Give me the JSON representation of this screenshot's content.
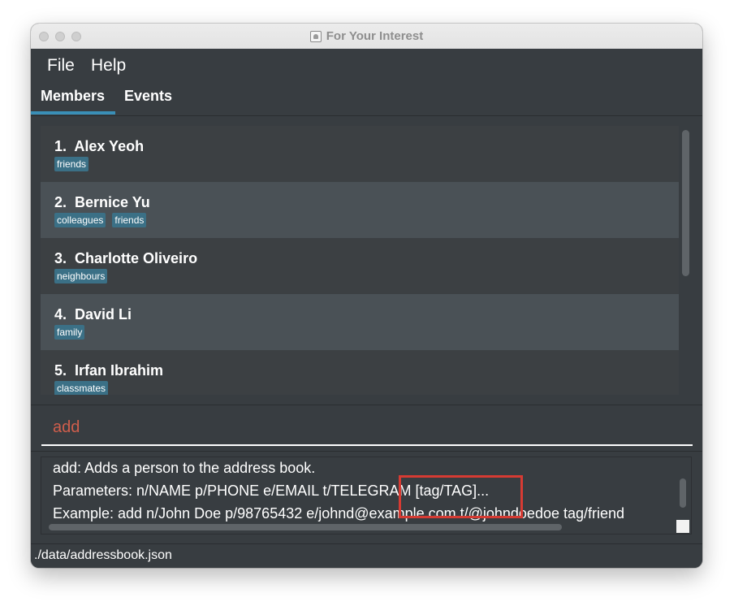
{
  "window": {
    "title": "For Your Interest"
  },
  "menu": {
    "file": "File",
    "help": "Help"
  },
  "tabs": {
    "members": "Members",
    "events": "Events"
  },
  "members": [
    {
      "index": "1.",
      "name": "Alex Yeoh",
      "tags": [
        "friends"
      ]
    },
    {
      "index": "2.",
      "name": "Bernice Yu",
      "tags": [
        "colleagues",
        "friends"
      ]
    },
    {
      "index": "3.",
      "name": "Charlotte Oliveiro",
      "tags": [
        "neighbours"
      ]
    },
    {
      "index": "4.",
      "name": "David Li",
      "tags": [
        "family"
      ]
    },
    {
      "index": "5.",
      "name": "Irfan Ibrahim",
      "tags": [
        "classmates"
      ]
    }
  ],
  "command": {
    "value": "add"
  },
  "result": {
    "line1": "add: Adds a person to the address book.",
    "line2": "Parameters: n/NAME p/PHONE e/EMAIL t/TELEGRAM [tag/TAG]...",
    "line3": "Example: add n/John Doe p/98765432 e/johnd@example.com t/@johndoedoe tag/friend"
  },
  "status": {
    "path": "./data/addressbook.json"
  },
  "colors": {
    "accent": "#3a8fb7",
    "tag_bg": "#3b7086",
    "command_text": "#d05e4c",
    "highlight": "#d63b33"
  }
}
